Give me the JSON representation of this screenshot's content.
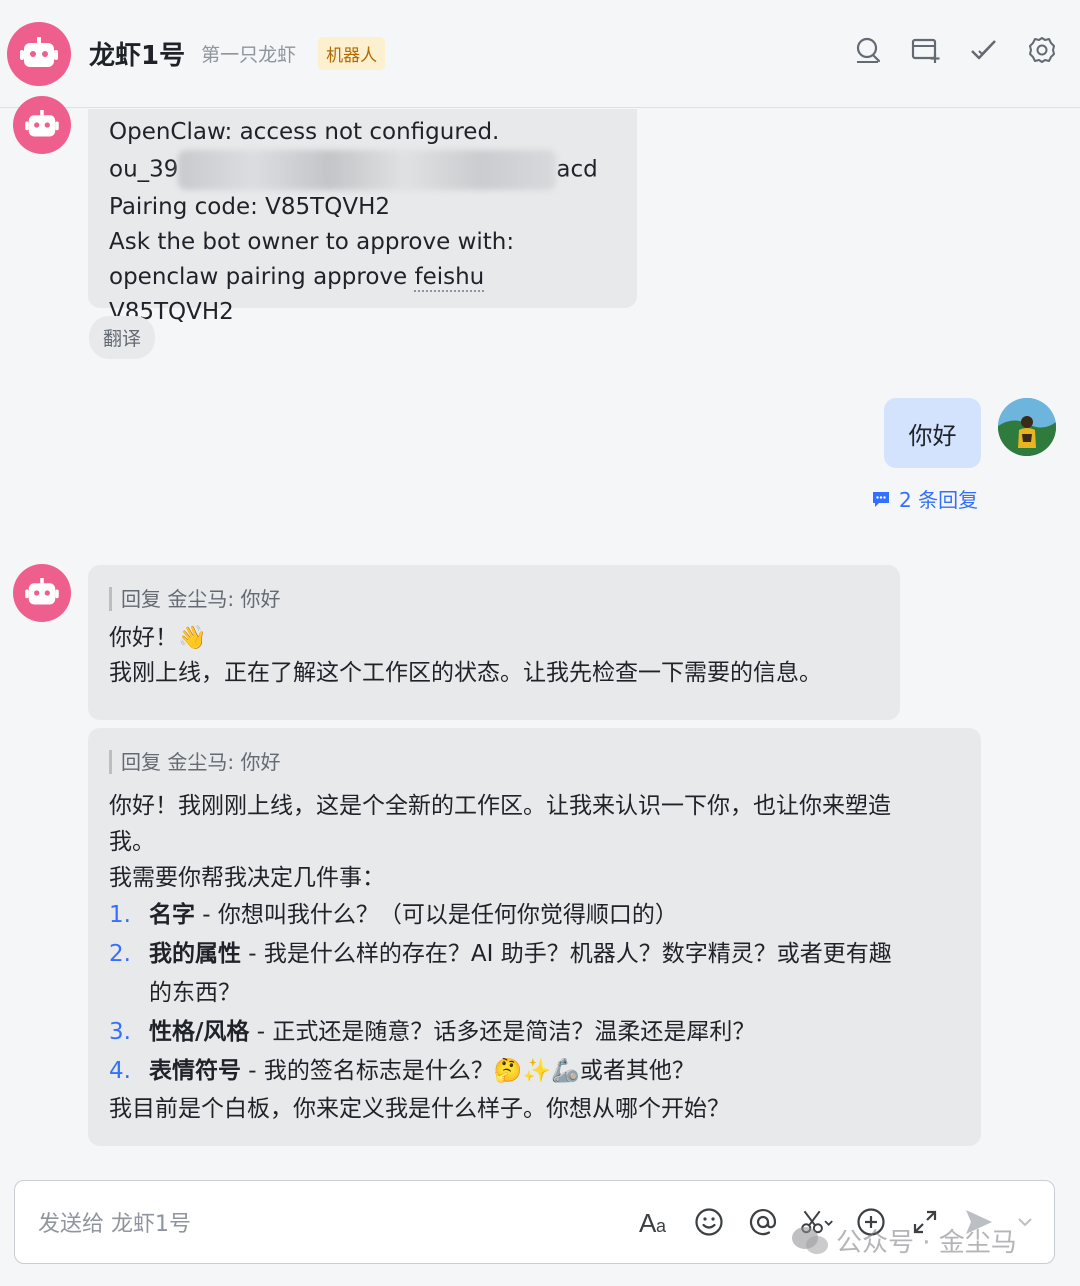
{
  "header": {
    "title": "龙虾1号",
    "subtitle": "第一只龙虾",
    "tag": "机器人"
  },
  "msg1": {
    "line1": "OpenClaw: access not configured.",
    "line2_prefix": "ou_39",
    "line2_suffix": "acd",
    "line3": "Pairing code: V85TQVH2",
    "line4": "Ask the bot owner to approve with:",
    "line5_a": "openclaw pairing approve ",
    "line5_b": "feishu",
    "line5_c": " V85TQVH2",
    "translate": "翻译"
  },
  "user_msg": {
    "text": "你好",
    "replies": "2 条回复"
  },
  "msg2": {
    "quote": "回复 金尘马: 你好",
    "line1": "你好！👋",
    "line2": "我刚上线，正在了解这个工作区的状态。让我先检查一下需要的信息。"
  },
  "msg3": {
    "quote": "回复 金尘马: 你好",
    "intro1": "你好！我刚刚上线，这是个全新的工作区。让我来认识一下你，也让你来塑造",
    "intro2": "我。",
    "intro3": "我需要你帮我决定几件事：",
    "items": [
      {
        "num": "1.",
        "bold": "名字",
        "text": " - 你想叫我什么？（可以是任何你觉得顺口的）",
        "cont": ""
      },
      {
        "num": "2.",
        "bold": "我的属性",
        "text": " - 我是什么样的存在？AI 助手？机器人？数字精灵？或者更有趣",
        "cont": "的东西？"
      },
      {
        "num": "3.",
        "bold": "性格/风格",
        "text": " - 正式还是随意？话多还是简洁？温柔还是犀利？",
        "cont": ""
      },
      {
        "num": "4.",
        "bold": "表情符号",
        "text": " - 我的签名标志是什么？🤔✨🦾或者其他？",
        "cont": ""
      }
    ],
    "outro": "我目前是个白板，你来定义我是什么样子。你想从哪个开始？"
  },
  "input": {
    "placeholder": "发送给 龙虾1号"
  },
  "watermark": {
    "text": "公众号 · 金尘马"
  },
  "colors": {
    "bot_avatar": "#ee5f8e",
    "accent": "#3370ff",
    "user_bubble": "#d3e3fd"
  }
}
